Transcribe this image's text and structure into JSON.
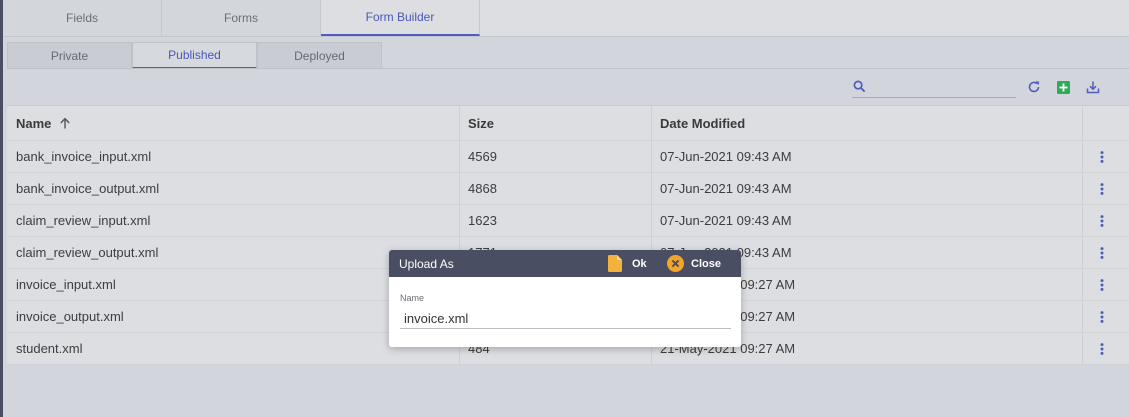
{
  "top_tabs": [
    {
      "label": "Fields",
      "active": false
    },
    {
      "label": "Forms",
      "active": false
    },
    {
      "label": "Form Builder",
      "active": true
    }
  ],
  "sub_tabs": [
    {
      "label": "Private",
      "active": false
    },
    {
      "label": "Published",
      "active": true
    },
    {
      "label": "Deployed",
      "active": false
    }
  ],
  "toolbar": {
    "search_value": "",
    "search_placeholder": "",
    "icons": [
      "search-icon",
      "refresh-icon",
      "add-icon",
      "download-icon"
    ]
  },
  "table": {
    "columns": [
      "Name",
      "Size",
      "Date Modified"
    ],
    "sort": {
      "column": "Name",
      "direction": "asc"
    },
    "rows": [
      {
        "name": "bank_invoice_input.xml",
        "size": "4569",
        "date": "07-Jun-2021 09:43 AM"
      },
      {
        "name": "bank_invoice_output.xml",
        "size": "4868",
        "date": "07-Jun-2021 09:43 AM"
      },
      {
        "name": "claim_review_input.xml",
        "size": "1623",
        "date": "07-Jun-2021 09:43 AM"
      },
      {
        "name": "claim_review_output.xml",
        "size": "1771",
        "date": "07-Jun-2021 09:43 AM"
      },
      {
        "name": "invoice_input.xml",
        "size": "",
        "date": "21-May-2021 09:27 AM"
      },
      {
        "name": "invoice_output.xml",
        "size": "",
        "date": "21-May-2021 09:27 AM"
      },
      {
        "name": "student.xml",
        "size": "484",
        "date": "21-May-2021 09:27 AM"
      }
    ]
  },
  "dialog": {
    "title": "Upload As",
    "ok_label": "Ok",
    "close_label": "Close",
    "field_label": "Name",
    "field_value": "invoice.xml"
  },
  "colors": {
    "accent": "#4f5dbd",
    "dialog_header": "#4a4e63",
    "ok_icon": "#f2b33d",
    "close_icon": "#f2a628",
    "add_icon": "#2eaa58"
  }
}
